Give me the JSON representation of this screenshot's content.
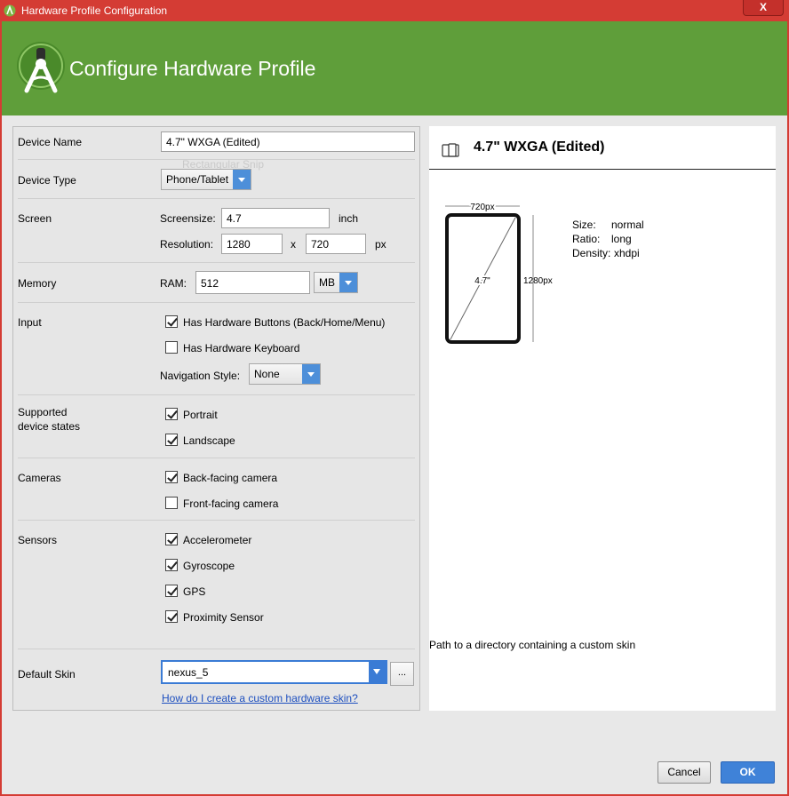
{
  "window": {
    "title": "Hardware Profile Configuration",
    "close_label": "X"
  },
  "banner": {
    "heading": "Configure Hardware Profile"
  },
  "form": {
    "device_name": {
      "label": "Device Name",
      "value": "4.7\" WXGA (Edited)"
    },
    "overlay_text": "Rectangular Snip",
    "device_type": {
      "label": "Device Type",
      "value": "Phone/Tablet"
    },
    "screen": {
      "label": "Screen",
      "screensize_label": "Screensize:",
      "screensize_value": "4.7",
      "screensize_unit": "inch",
      "resolution_label": "Resolution:",
      "res_width": "1280",
      "res_sep": "x",
      "res_height": "720",
      "res_unit": "px"
    },
    "memory": {
      "label": "Memory",
      "ram_label": "RAM:",
      "ram_value": "512",
      "ram_unit": "MB"
    },
    "input": {
      "label": "Input",
      "hw_buttons": "Has Hardware Buttons (Back/Home/Menu)",
      "hw_buttons_checked": true,
      "hw_keyboard": "Has Hardware Keyboard",
      "hw_keyboard_checked": false,
      "nav_label": "Navigation Style:",
      "nav_value": "None"
    },
    "states": {
      "label_line1": "Supported",
      "label_line2": "device states",
      "portrait": "Portrait",
      "portrait_checked": true,
      "landscape": "Landscape",
      "landscape_checked": true
    },
    "cameras": {
      "label": "Cameras",
      "back": "Back-facing camera",
      "back_checked": true,
      "front": "Front-facing camera",
      "front_checked": false
    },
    "sensors": {
      "label": "Sensors",
      "accelerometer": "Accelerometer",
      "gyroscope": "Gyroscope",
      "gps": "GPS",
      "proximity": "Proximity Sensor"
    },
    "skin": {
      "label": "Default Skin",
      "value": "nexus_5",
      "browse": "...",
      "help_link": "How do I create a custom hardware skin?"
    }
  },
  "preview": {
    "title": "4.7\" WXGA (Edited)",
    "width_label": "720px",
    "height_label": "1280px",
    "diag_label": "4.7\"",
    "size_label": "Size:",
    "size_value": "normal",
    "ratio_label": "Ratio:",
    "ratio_value": "long",
    "density_label": "Density:",
    "density_value": "xhdpi",
    "skin_hint": "Path to a directory containing a custom skin"
  },
  "buttons": {
    "cancel": "Cancel",
    "ok": "OK"
  },
  "colors": {
    "titlebar": "#d43c34",
    "banner": "#5f9e3a",
    "accent": "#3f82d8"
  }
}
